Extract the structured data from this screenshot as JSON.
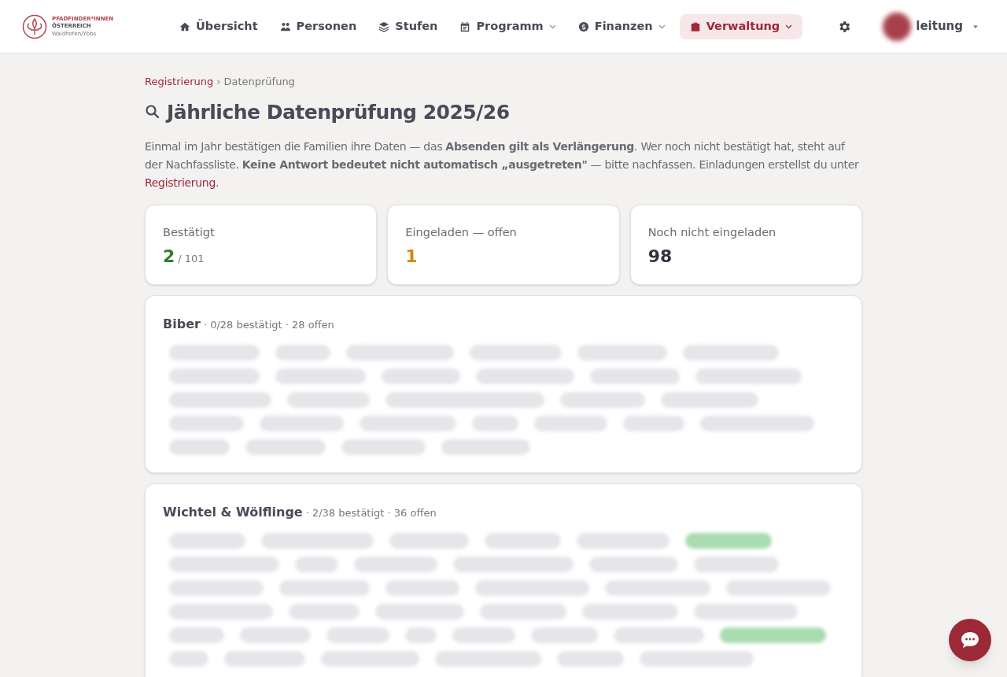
{
  "logo": {
    "line_1": "PFADFINDER*INNEN",
    "line_2": "ÖSTERREICH",
    "line_3": "Waidhofen/Ybbs"
  },
  "nav": [
    {
      "label": "Übersicht",
      "dropdown": false,
      "selected": false
    },
    {
      "label": "Personen",
      "dropdown": false,
      "selected": false
    },
    {
      "label": "Stufen",
      "dropdown": false,
      "selected": false
    },
    {
      "label": "Programm",
      "dropdown": true,
      "selected": false
    },
    {
      "label": "Finanzen",
      "dropdown": true,
      "selected": false
    },
    {
      "label": "Verwaltung",
      "dropdown": true,
      "selected": true
    }
  ],
  "user": {
    "name": "leitung"
  },
  "breadcrumb": [
    {
      "label": "Registrierung",
      "link": true
    },
    {
      "label": "Datenprüfung",
      "link": false
    }
  ],
  "breadcrumb_separator": "›",
  "title": "Jährliche Datenprüfung 2025/26",
  "intro": {
    "text": "Einmal im Jahr bestätigen die Familien ihre Daten — das **Absenden gilt als Verlängerung**. Wer noch nicht bestätigt hat, steht auf der Nachfassliste. **Keine Antwort bedeutet nicht automatisch „ausgetreten\"** — bitte nachfassen. Einladungen erstellst du unter ",
    "link": "Registrierung",
    "end": "."
  },
  "stats": [
    {
      "label": "Bestätigt",
      "value": "2",
      "total": "/ 101",
      "kind": "confirmed"
    },
    {
      "label": "Eingeladen — offen",
      "value": "1",
      "kind": "pending"
    },
    {
      "label": "Noch nicht eingeladen",
      "value": "98",
      "kind": "neutral"
    }
  ],
  "groups": [
    {
      "name": "Biber",
      "summary": "· 0/28 bestätigt · 28 offen",
      "members": [
        {
          "confirmed": false
        },
        {
          "confirmed": false
        },
        {
          "confirmed": false
        },
        {
          "confirmed": false
        },
        {
          "confirmed": false
        },
        {
          "confirmed": false
        },
        {
          "confirmed": false
        },
        {
          "confirmed": false
        },
        {
          "confirmed": false
        },
        {
          "confirmed": false
        },
        {
          "confirmed": false
        },
        {
          "confirmed": false
        },
        {
          "confirmed": false
        },
        {
          "confirmed": false
        },
        {
          "confirmed": false
        },
        {
          "confirmed": false
        },
        {
          "confirmed": false
        },
        {
          "confirmed": false
        },
        {
          "confirmed": false
        },
        {
          "confirmed": false
        },
        {
          "confirmed": false
        },
        {
          "confirmed": false
        },
        {
          "confirmed": false
        },
        {
          "confirmed": false
        },
        {
          "confirmed": false
        },
        {
          "confirmed": false
        },
        {
          "confirmed": false
        },
        {
          "confirmed": false
        }
      ]
    },
    {
      "name": "Wichtel & Wölflinge",
      "summary": "· 2/38 bestätigt · 36 offen",
      "members": [
        {
          "confirmed": false
        },
        {
          "confirmed": false
        },
        {
          "confirmed": false
        },
        {
          "confirmed": false
        },
        {
          "confirmed": false
        },
        {
          "confirmed": true
        },
        {
          "confirmed": false
        },
        {
          "confirmed": false
        },
        {
          "confirmed": false
        },
        {
          "confirmed": false
        },
        {
          "confirmed": false
        },
        {
          "confirmed": false
        },
        {
          "confirmed": false
        },
        {
          "confirmed": false
        },
        {
          "confirmed": false
        },
        {
          "confirmed": false
        },
        {
          "confirmed": false
        },
        {
          "confirmed": false
        },
        {
          "confirmed": false
        },
        {
          "confirmed": false
        },
        {
          "confirmed": false
        },
        {
          "confirmed": false
        },
        {
          "confirmed": false
        },
        {
          "confirmed": false
        },
        {
          "confirmed": false
        },
        {
          "confirmed": false
        },
        {
          "confirmed": false
        },
        {
          "confirmed": false
        },
        {
          "confirmed": false
        },
        {
          "confirmed": false
        },
        {
          "confirmed": false
        },
        {
          "confirmed": true
        },
        {
          "confirmed": false
        },
        {
          "confirmed": false
        },
        {
          "confirmed": false
        },
        {
          "confirmed": false
        },
        {
          "confirmed": false
        },
        {
          "confirmed": false
        }
      ]
    }
  ]
}
